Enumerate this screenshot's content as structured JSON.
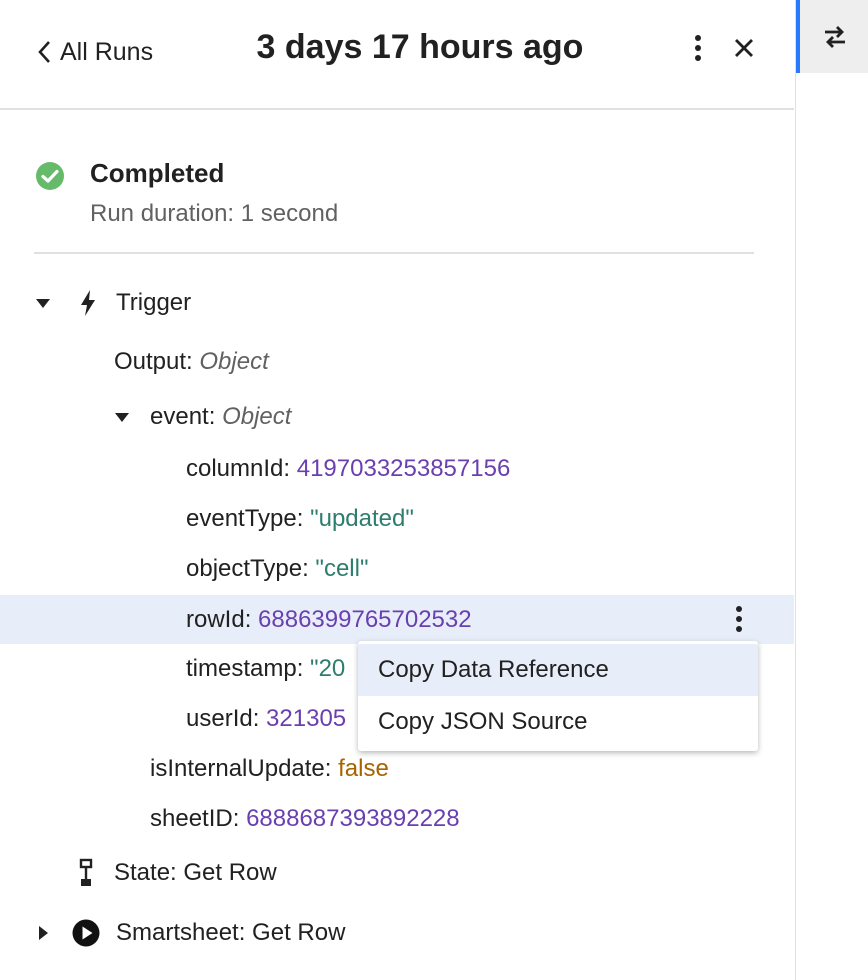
{
  "header": {
    "back_label": "All Runs",
    "title": "3 days 17 hours ago"
  },
  "status": {
    "title": "Completed",
    "duration": "Run duration: 1 second",
    "color": "#66bb6a"
  },
  "tree": {
    "trigger_label": "Trigger",
    "output_key": "Output:",
    "output_type": "Object",
    "event_key": "event:",
    "event_type": "Object",
    "fields": {
      "columnId": {
        "key": "columnId:",
        "value": "4197033253857156"
      },
      "eventType": {
        "key": "eventType:",
        "value": "\"updated\""
      },
      "objectType": {
        "key": "objectType:",
        "value": "\"cell\""
      },
      "rowId": {
        "key": "rowId:",
        "value": "6886399765702532"
      },
      "timestamp": {
        "key": "timestamp:",
        "value": "\"20"
      },
      "userId": {
        "key": "userId:",
        "value": "321305"
      }
    },
    "isInternalUpdate": {
      "key": "isInternalUpdate:",
      "value": "false"
    },
    "sheetID": {
      "key": "sheetID:",
      "value": "6888687393892228"
    },
    "state_step": "State: Get Row",
    "smartsheet_step": "Smartsheet: Get Row"
  },
  "context_menu": {
    "items": [
      "Copy Data Reference",
      "Copy JSON Source"
    ]
  },
  "colors": {
    "number": "#6a3fb0",
    "string": "#2e7d6e",
    "boolean": "#a66300",
    "highlight": "#e8eef9",
    "accent": "#2979ff"
  }
}
